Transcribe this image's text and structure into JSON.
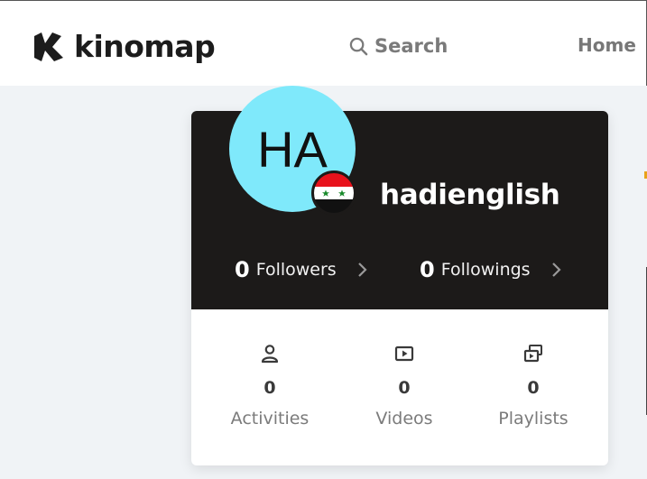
{
  "header": {
    "logo_text": "kinomap",
    "search_label": "Search",
    "nav_home": "Home"
  },
  "profile": {
    "avatar_initials": "HA",
    "avatar_color": "#7fe9fb",
    "username": "hadienglish",
    "flag": "syria-flag-icon",
    "followers": {
      "count": "0",
      "label": "Followers"
    },
    "followings": {
      "count": "0",
      "label": "Followings"
    },
    "stats": [
      {
        "icon": "user-icon",
        "count": "0",
        "label": "Activities"
      },
      {
        "icon": "video-icon",
        "count": "0",
        "label": "Videos"
      },
      {
        "icon": "playlist-icon",
        "count": "0",
        "label": "Playlists"
      }
    ]
  },
  "colors": {
    "card_dark": "#1c1a19",
    "page_bg": "#f0f3f6"
  }
}
